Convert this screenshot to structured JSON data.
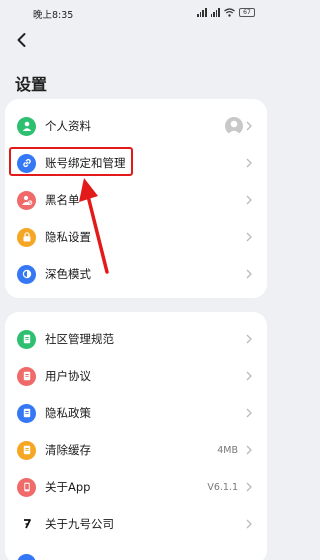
{
  "status_bar": {
    "time": "晚上8:35",
    "battery": "67"
  },
  "header": {
    "title": "设置"
  },
  "section1": [
    {
      "label": "个人资料",
      "icon": "person-icon",
      "color": "#2fbf71"
    },
    {
      "label": "账号绑定和管理",
      "icon": "link-icon",
      "color": "#3478f6"
    },
    {
      "label": "黑名单",
      "icon": "person-blocked-icon",
      "color": "#f06a6a"
    },
    {
      "label": "隐私设置",
      "icon": "lock-icon",
      "color": "#f5a623"
    },
    {
      "label": "深色模式",
      "icon": "half-circle-icon",
      "color": "#3478f6"
    }
  ],
  "section2": [
    {
      "label": "社区管理规范",
      "icon": "document-icon",
      "color": "#2fbf71"
    },
    {
      "label": "用户协议",
      "icon": "document-icon",
      "color": "#f06a6a"
    },
    {
      "label": "隐私政策",
      "icon": "document-icon",
      "color": "#3478f6"
    },
    {
      "label": "清除缓存",
      "icon": "document-icon",
      "color": "#f5a623",
      "value": "4MB"
    },
    {
      "label": "关于App",
      "icon": "phone-icon",
      "color": "#f06a6a",
      "value": "V6.1.1"
    },
    {
      "label": "关于九号公司",
      "icon": "ninebot-logo-icon",
      "color": "#111111"
    }
  ],
  "annotation": {
    "highlight_color": "#e21a1a"
  }
}
